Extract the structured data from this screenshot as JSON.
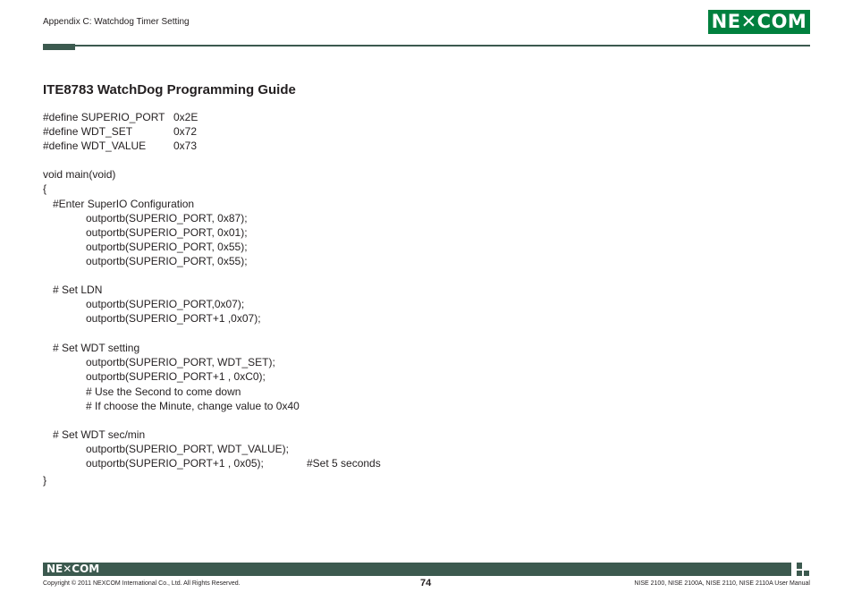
{
  "header": {
    "section": "Appendix C: Watchdog Timer Setting",
    "logo": "NE✕COM",
    "colors": {
      "brand_green": "#00803e",
      "rule": "#3c5a4f"
    }
  },
  "title": "ITE8783 WatchDog Programming Guide",
  "defines": [
    {
      "name": "#define SUPERIO_PORT",
      "value": "0x2E"
    },
    {
      "name": "#define WDT_SET",
      "value": "0x72"
    },
    {
      "name": "#define WDT_VALUE",
      "value": "0x73"
    }
  ],
  "code": {
    "main_signature": "void main(void)",
    "open_brace": "{",
    "enter_comment": "#Enter SuperIO Configuration",
    "enter_lines": [
      "outportb(SUPERIO_PORT, 0x87);",
      "outportb(SUPERIO_PORT, 0x01);",
      "outportb(SUPERIO_PORT, 0x55);",
      "outportb(SUPERIO_PORT, 0x55);"
    ],
    "ldn_comment": "# Set LDN",
    "ldn_lines": [
      "outportb(SUPERIO_PORT,0x07);",
      "outportb(SUPERIO_PORT+1 ,0x07);"
    ],
    "wdt_comment": "# Set WDT setting",
    "wdt_lines": [
      "outportb(SUPERIO_PORT, WDT_SET);",
      "outportb(SUPERIO_PORT+1 , 0xC0);",
      "# Use the Second to come down",
      "# If choose the Minute, change value to 0x40"
    ],
    "sec_comment": "# Set WDT sec/min",
    "sec_line_1": "outportb(SUPERIO_PORT, WDT_VALUE);",
    "sec_line_2": "outportb(SUPERIO_PORT+1 , 0x05);",
    "sec_line_2_comment": "#Set 5 seconds",
    "close_brace": "}"
  },
  "footer": {
    "logo": "NE✕COM",
    "copyright": "Copyright © 2011 NEXCOM International Co., Ltd. All Rights Reserved.",
    "page_number": "74",
    "manual": "NISE 2100, NISE 2100A, NISE 2110, NISE 2110A User Manual"
  }
}
